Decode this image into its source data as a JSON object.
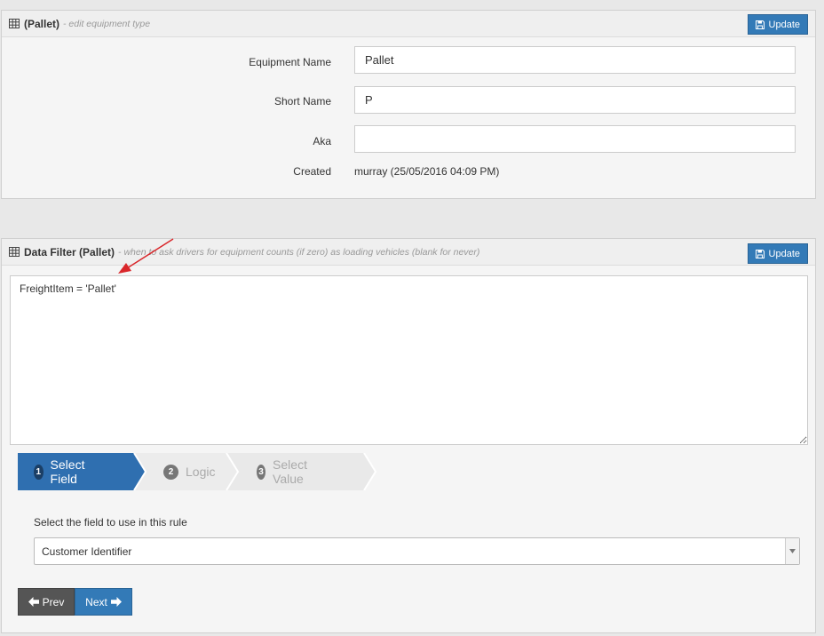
{
  "equipment_panel": {
    "title": "(Pallet)",
    "subtitle": "- edit equipment type",
    "update_label": "Update",
    "fields": {
      "equipment_name_label": "Equipment Name",
      "equipment_name_value": "Pallet",
      "short_name_label": "Short Name",
      "short_name_value": "P",
      "aka_label": "Aka",
      "aka_value": "",
      "created_label": "Created",
      "created_value": "murray (25/05/2016 04:09 PM)"
    }
  },
  "filter_panel": {
    "title": "Data Filter (Pallet)",
    "subtitle": "- when to ask drivers for equipment counts (if zero) as loading vehicles (blank for never)",
    "update_label": "Update",
    "filter_expression": "FreightItem = 'Pallet'"
  },
  "wizard": {
    "steps": [
      {
        "num": "1",
        "label": "Select Field",
        "active": true
      },
      {
        "num": "2",
        "label": "Logic",
        "active": false
      },
      {
        "num": "3",
        "label": "Select Value",
        "active": false
      }
    ],
    "rule_label": "Select the field to use in this rule",
    "selected_field": "Customer Identifier",
    "prev_label": "Prev",
    "next_label": "Next"
  },
  "icons": {
    "panel": "table-grid-icon",
    "update": "floppy-save-icon",
    "prev": "arrow-left-icon",
    "next": "arrow-right-icon",
    "select": "caret-down-icon",
    "annotation": "red-arrow-annotation"
  },
  "colors": {
    "primary": "#337ab7",
    "prev_button": "#555555",
    "wizard_inactive": "#e6e6e6",
    "annotation": "#d9262a"
  }
}
